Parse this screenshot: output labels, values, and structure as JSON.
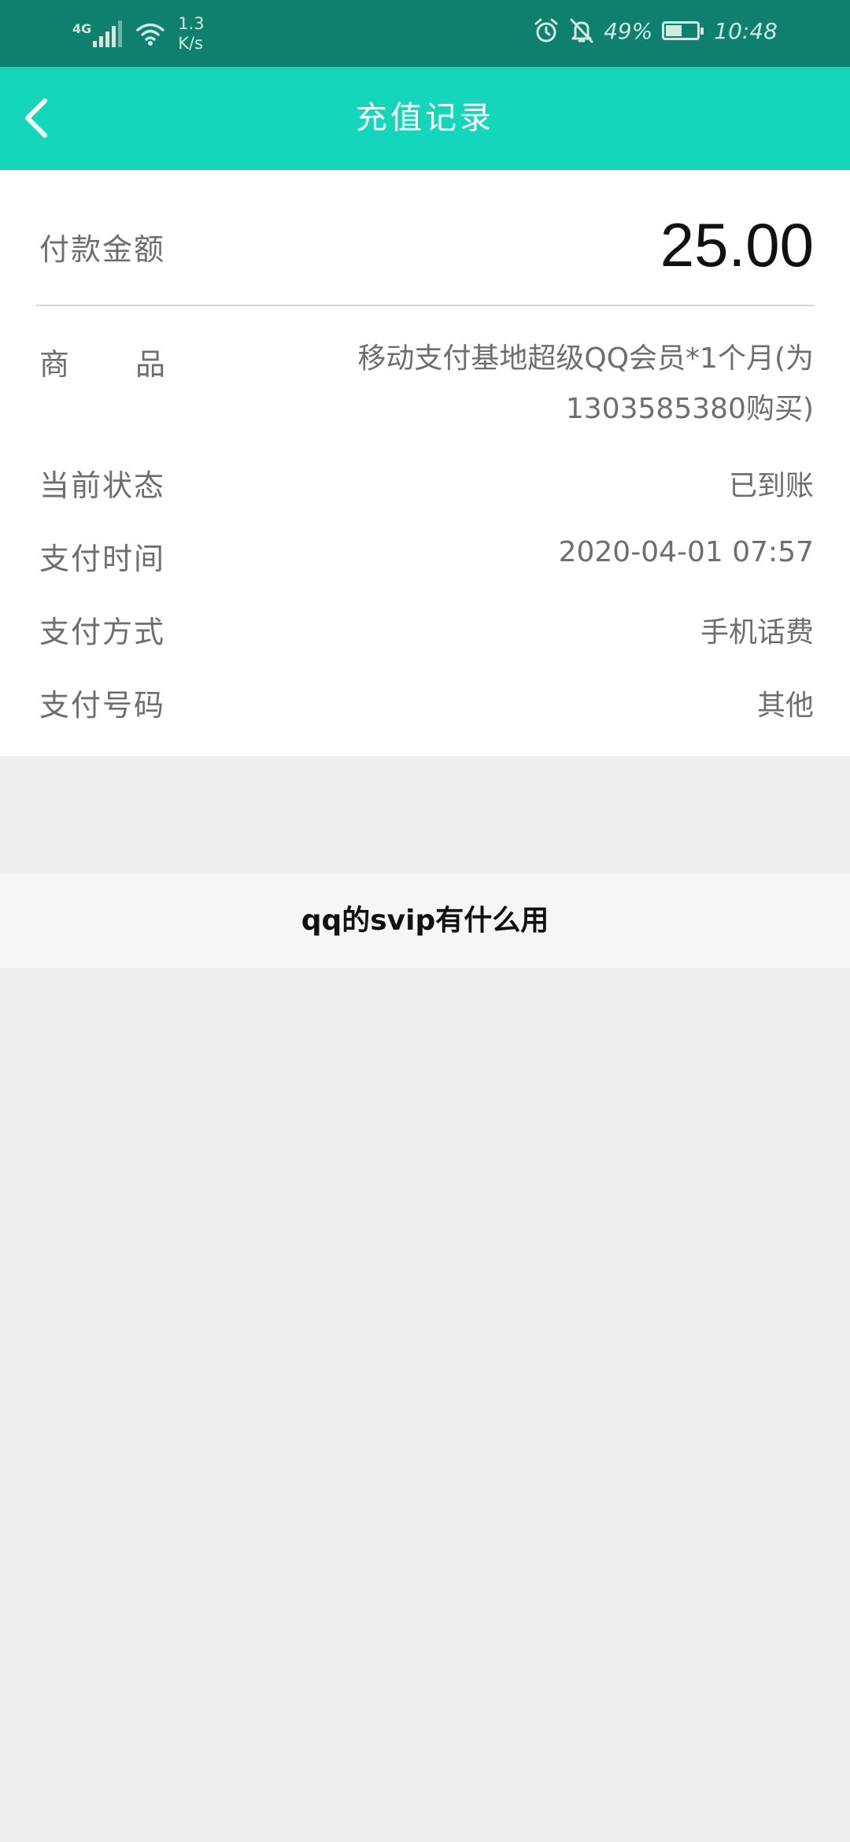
{
  "status_bar": {
    "network": "4G",
    "speed_value": "1.3",
    "speed_unit": "K/s",
    "battery": "49%",
    "time": "10:48"
  },
  "header": {
    "title": "充值记录"
  },
  "record": {
    "amount_label": "付款金额",
    "amount_value": "25.00",
    "product_label_left": "商",
    "product_label_right": "品",
    "product_value": "移动支付基地超级QQ会员*1个月(为1303585380购买)",
    "status_label": "当前状态",
    "status_value": "已到账",
    "pay_time_label": "支付时间",
    "pay_time_value": "2020-04-01 07:57",
    "pay_method_label": "支付方式",
    "pay_method_value": "手机话费",
    "pay_number_label": "支付号码",
    "pay_number_value": "其他"
  },
  "footer": {
    "title": "qq的svip有什么用"
  },
  "colors": {
    "status_bar": "#0f7f6e",
    "title_bar": "#13d6bb",
    "background": "#efeff4"
  }
}
